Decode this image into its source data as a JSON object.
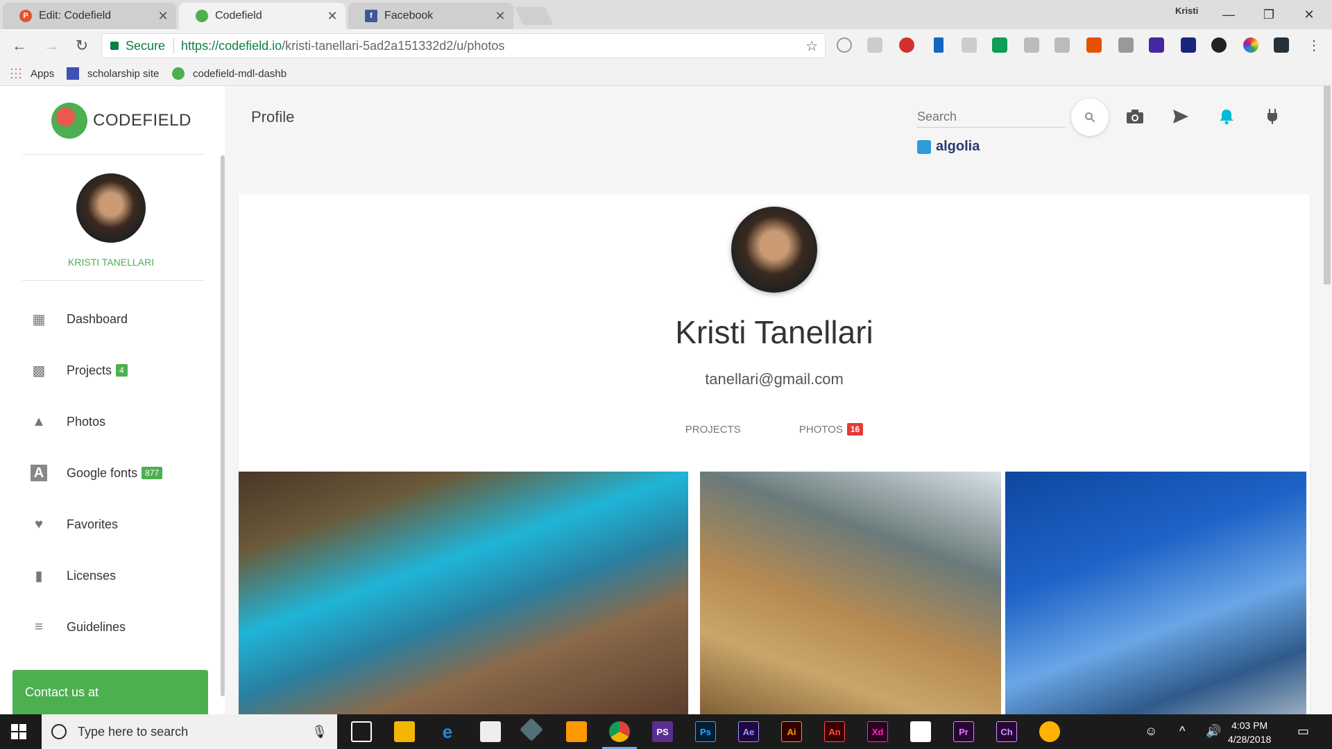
{
  "browser": {
    "tabs": [
      {
        "label": "Edit: Codefield",
        "favicon_color": "#e2532e",
        "favicon_letter": "P"
      },
      {
        "label": "Codefield",
        "favicon_color": "#4caf50",
        "favicon_letter": ""
      },
      {
        "label": "Facebook",
        "favicon_color": "#3b5998",
        "favicon_letter": "f"
      }
    ],
    "window_user": "Kristi",
    "secure_label": "Secure",
    "url_host": "https://codefield.io",
    "url_path": "/kristi-tanellari-5ad2a151332d2/u/photos",
    "bookmarks": [
      "Apps",
      "scholarship site",
      "codefield-mdl-dashb"
    ]
  },
  "sidebar": {
    "brand": "CODEFIELD",
    "username": "KRISTI TANELLARI",
    "items": [
      {
        "label": "Dashboard",
        "icon": "dashboard-icon",
        "badge": ""
      },
      {
        "label": "Projects",
        "icon": "projects-icon",
        "badge": "4"
      },
      {
        "label": "Photos",
        "icon": "photos-icon",
        "badge": ""
      },
      {
        "label": "Google fonts",
        "icon": "font-icon",
        "badge": "877"
      },
      {
        "label": "Favorites",
        "icon": "heart-icon",
        "badge": ""
      },
      {
        "label": "Licenses",
        "icon": "book-icon",
        "badge": ""
      },
      {
        "label": "Guidelines",
        "icon": "list-icon",
        "badge": ""
      }
    ],
    "contact_label": "Contact us at"
  },
  "header": {
    "title": "Profile",
    "search_placeholder": "Search",
    "algolia": "algolia",
    "accent": "#4caf50",
    "bell_color": "#00bcd4"
  },
  "profile": {
    "name": "Kristi Tanellari",
    "email": "tanellari@gmail.com",
    "tabs": [
      {
        "label": "PROJECTS",
        "count": ""
      },
      {
        "label": "PHOTOS",
        "count": "16"
      }
    ]
  },
  "taskbar": {
    "search_placeholder": "Type here to search",
    "time": "4:03 PM",
    "date": "4/28/2018",
    "apps": [
      "Ps",
      "Ae",
      "Ai",
      "An",
      "Xd",
      "Pr",
      "Ch"
    ]
  }
}
